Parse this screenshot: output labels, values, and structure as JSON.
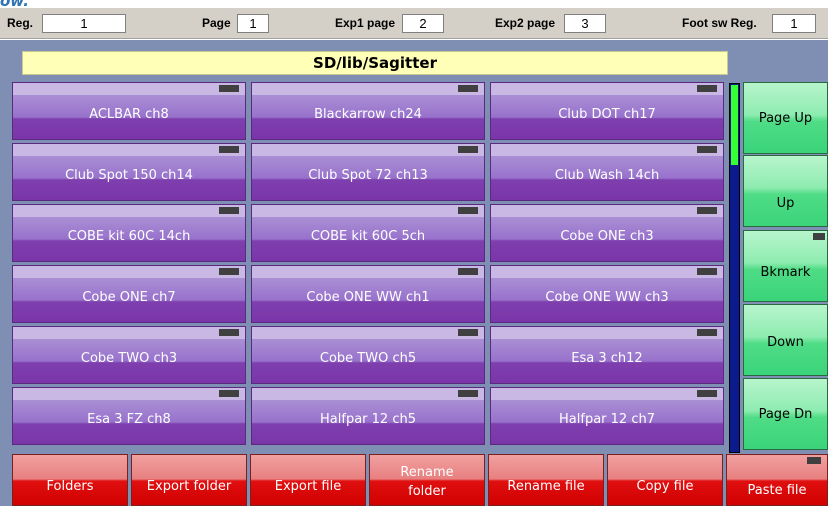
{
  "caption": "ow.",
  "topbar": {
    "reg_label": "Reg.",
    "reg_value": "1",
    "page_label": "Page",
    "page_value": "1",
    "exp1_label": "Exp1 page",
    "exp1_value": "2",
    "exp2_label": "Exp2 page",
    "exp2_value": "3",
    "foot_label": "Foot sw Reg.",
    "foot_value": "1"
  },
  "path": "SD/lib/Sagitter",
  "files": [
    [
      "ACLBAR ch8",
      "Blackarrow ch24",
      "Club DOT ch17"
    ],
    [
      "Club Spot 150 ch14",
      "Club Spot 72 ch13",
      "Club Wash 14ch"
    ],
    [
      "COBE kit 60C 14ch",
      "COBE kit 60C 5ch",
      "Cobe ONE ch3"
    ],
    [
      "Cobe ONE ch7",
      "Cobe ONE WW ch1",
      "Cobe ONE WW ch3"
    ],
    [
      "Cobe TWO ch3",
      "Cobe TWO ch5",
      "Esa 3 ch12"
    ],
    [
      "Esa 3 FZ ch8",
      "Halfpar 12 ch5",
      "Halfpar 12 ch7"
    ]
  ],
  "nav": {
    "page_up": "Page Up",
    "up": "Up",
    "bkmark": "Bkmark",
    "down": "Down",
    "page_dn": "Page Dn"
  },
  "actions": {
    "folders": "Folders",
    "export_folder": "Export folder",
    "export_file": "Export file",
    "rename_folder_1": "Rename",
    "rename_folder_2": "folder",
    "rename_file": "Rename file",
    "copy_file": "Copy file",
    "paste_file": "Paste file"
  },
  "colors": {
    "file_button": "#7a35a8",
    "nav_button": "#3ad47a",
    "action_button": "#d20000",
    "path_bar": "#ffffb8",
    "background": "#7e8fb3"
  }
}
